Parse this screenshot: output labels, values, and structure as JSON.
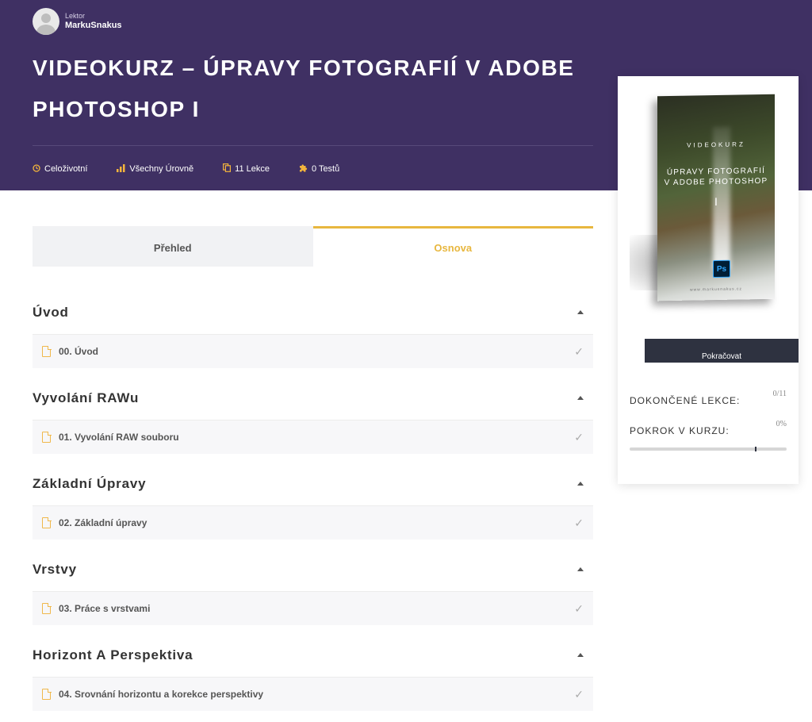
{
  "instructor": {
    "role": "Lektor",
    "name": "MarkuSnakus"
  },
  "course": {
    "title": "VIDEOKURZ – ÚPRAVY FOTOGRAFIÍ V ADOBE PHOTOSHOP I",
    "meta": {
      "duration": "Celoživotní",
      "level": "Všechny Úrovně",
      "lessons": "11 Lekce",
      "quizzes": "0 Testů"
    }
  },
  "tabs": {
    "overview": "Přehled",
    "curriculum": "Osnova"
  },
  "curriculum": {
    "sections": [
      {
        "title": "Úvod",
        "lessons": [
          {
            "title": "00. Úvod"
          }
        ]
      },
      {
        "title": "Vyvolání RAWu",
        "lessons": [
          {
            "title": "01. Vyvolání RAW souboru"
          }
        ]
      },
      {
        "title": "Základní Úpravy",
        "lessons": [
          {
            "title": "02. Základní úpravy"
          }
        ]
      },
      {
        "title": "Vrstvy",
        "lessons": [
          {
            "title": "03. Práce s vrstvami"
          }
        ]
      },
      {
        "title": "Horizont A Perspektiva",
        "lessons": [
          {
            "title": "04. Srovnání horizontu a korekce perspektivy"
          }
        ]
      }
    ]
  },
  "cover": {
    "top": "VIDEOKURZ",
    "line1": "ÚPRAVY FOTOGRAFIÍ",
    "line2": "V ADOBE PHOTOSHOP",
    "num": "I",
    "ps": "Ps",
    "site": "www.markusnakus.cz"
  },
  "sidebar": {
    "continue_label": "Pokračovat",
    "completed_label": "DOKONČENÉ LEKCE:",
    "completed_value": "0/11",
    "progress_label": "POKROK V KURZU:",
    "progress_value": "0%",
    "progress_fraction": 0
  },
  "colors": {
    "hero": "#3f3063",
    "accent": "#e8b73f",
    "button": "#2e3240"
  },
  "icons": {
    "duration": "clock-icon",
    "level": "bar-chart-icon",
    "lessons": "copy-icon",
    "quizzes": "puzzle-icon"
  }
}
